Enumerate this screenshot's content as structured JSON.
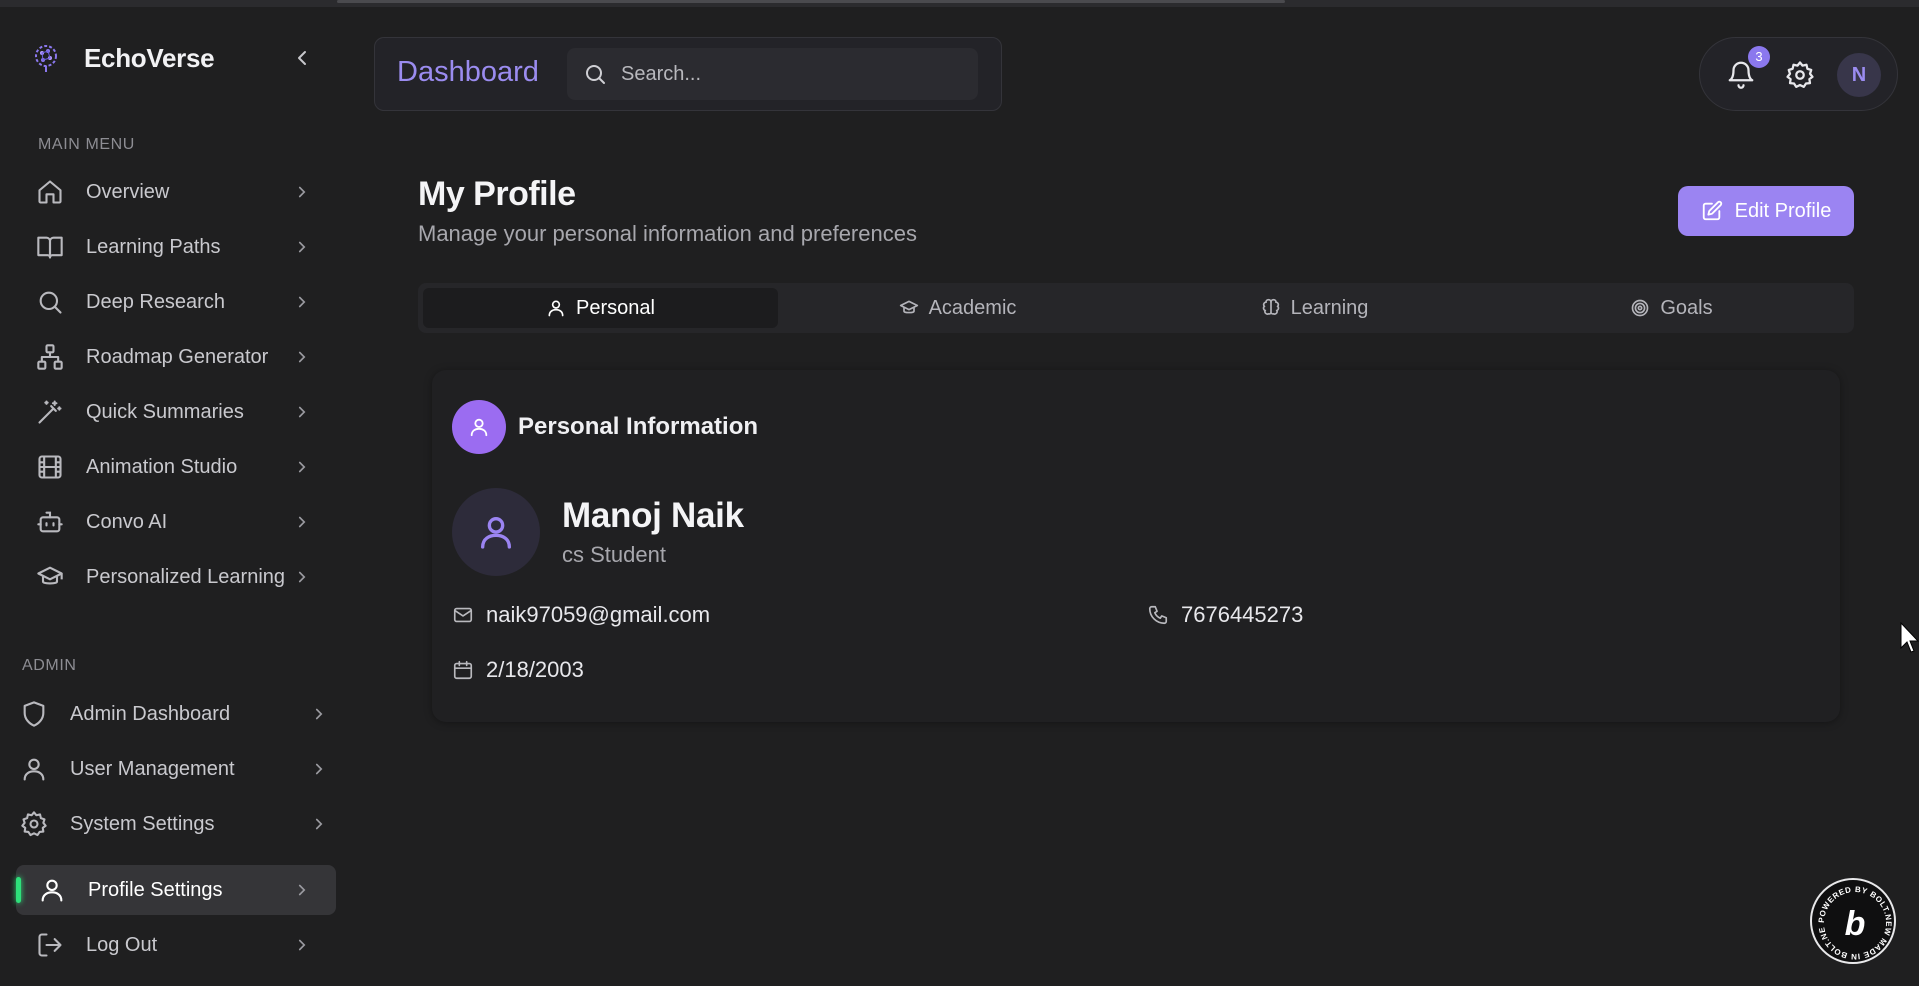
{
  "app": {
    "name": "EchoVerse",
    "accent_color": "#9b84f2",
    "active_indicator_color": "#2ee07a"
  },
  "sidebar": {
    "main_menu_label": "MAIN MENU",
    "main_items": [
      {
        "label": "Overview",
        "icon": "home-icon"
      },
      {
        "label": "Learning Paths",
        "icon": "book-open-icon"
      },
      {
        "label": "Deep Research",
        "icon": "search-icon"
      },
      {
        "label": "Roadmap Generator",
        "icon": "sitemap-icon"
      },
      {
        "label": "Quick Summaries",
        "icon": "magic-wand-icon"
      },
      {
        "label": "Animation Studio",
        "icon": "film-icon"
      },
      {
        "label": "Convo AI",
        "icon": "bot-icon"
      },
      {
        "label": "Personalized Learning",
        "icon": "graduation-cap-icon"
      }
    ],
    "admin_label": "ADMIN",
    "admin_items": [
      {
        "label": "Admin Dashboard",
        "icon": "shield-icon"
      },
      {
        "label": "User Management",
        "icon": "user-icon"
      },
      {
        "label": "System Settings",
        "icon": "gear-icon"
      },
      {
        "label": "Profile Settings",
        "icon": "user-icon",
        "active": true
      },
      {
        "label": "Log Out",
        "icon": "log-out-icon"
      }
    ]
  },
  "header": {
    "title": "Dashboard",
    "search_placeholder": "Search...",
    "notification_count": "3",
    "user_initial": "N"
  },
  "profile": {
    "title": "My Profile",
    "subtitle": "Manage your personal information and preferences",
    "edit_button": "Edit Profile",
    "tabs": [
      {
        "label": "Personal",
        "icon": "user-icon",
        "active": true
      },
      {
        "label": "Academic",
        "icon": "graduation-cap-icon"
      },
      {
        "label": "Learning",
        "icon": "brain-icon"
      },
      {
        "label": "Goals",
        "icon": "target-icon"
      }
    ],
    "section_title": "Personal Information",
    "name": "Manoj Naik",
    "role": "cs Student",
    "email": "naik97059@gmail.com",
    "phone": "7676445273",
    "birth_date": "2/18/2003"
  }
}
